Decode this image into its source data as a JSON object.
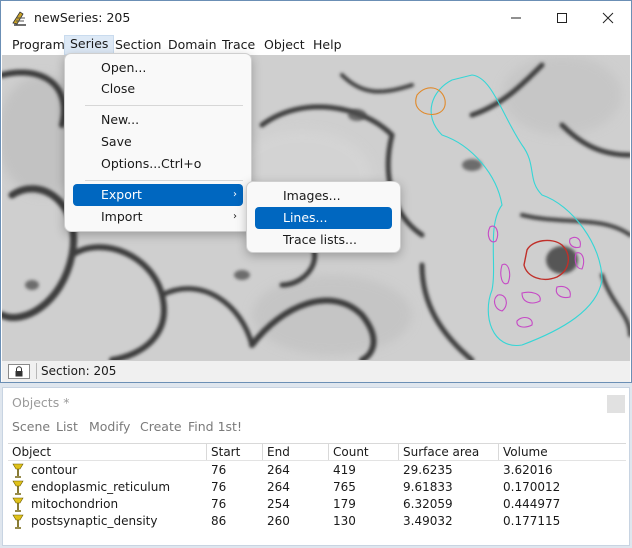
{
  "window": {
    "title": "newSeries: 205",
    "app_icon": "reconstruct-app-icon"
  },
  "menubar": {
    "items": [
      {
        "label": "Program"
      },
      {
        "label": "Series"
      },
      {
        "label": "Section"
      },
      {
        "label": "Domain"
      },
      {
        "label": "Trace"
      },
      {
        "label": "Object"
      },
      {
        "label": "Help"
      }
    ],
    "active": "Series"
  },
  "series_menu": {
    "items": [
      {
        "label": "Open..."
      },
      {
        "label": "Close"
      },
      {
        "label": "New..."
      },
      {
        "label": "Save"
      },
      {
        "label": "Options...",
        "shortcut": "Ctrl+o"
      },
      {
        "label": "Export",
        "submenu": true
      },
      {
        "label": "Import",
        "submenu": true
      }
    ],
    "highlighted": "Export"
  },
  "export_submenu": {
    "items": [
      {
        "label": "Images..."
      },
      {
        "label": "Lines..."
      },
      {
        "label": "Trace lists..."
      }
    ],
    "highlighted": "Lines..."
  },
  "statusbar": {
    "text": "Section: 205",
    "lock_icon": "lock-icon"
  },
  "objects_window": {
    "title": "Objects *",
    "menu": [
      "Scene",
      "List",
      "Modify",
      "Create",
      "Find 1st!"
    ],
    "columns": [
      "Object",
      "Start",
      "End",
      "Count",
      "Surface area",
      "Volume"
    ],
    "rows": [
      {
        "object": "contour",
        "start": "76",
        "end": "264",
        "count": "419",
        "surface_area": "29.6235",
        "volume": "3.62016"
      },
      {
        "object": "endoplasmic_reticulum",
        "start": "76",
        "end": "264",
        "count": "765",
        "surface_area": "9.61833",
        "volume": "0.170012"
      },
      {
        "object": "mitochondrion",
        "start": "76",
        "end": "254",
        "count": "179",
        "surface_area": "6.32059",
        "volume": "0.444977"
      },
      {
        "object": "postsynaptic_density",
        "start": "86",
        "end": "260",
        "count": "130",
        "surface_area": "3.49032",
        "volume": "0.177115"
      }
    ]
  },
  "colors": {
    "highlight": "#0067c0",
    "trace_cyan": "#35d6d6",
    "trace_orange": "#e08a2c",
    "trace_magenta": "#c64ac6",
    "trace_red": "#c0302a"
  }
}
